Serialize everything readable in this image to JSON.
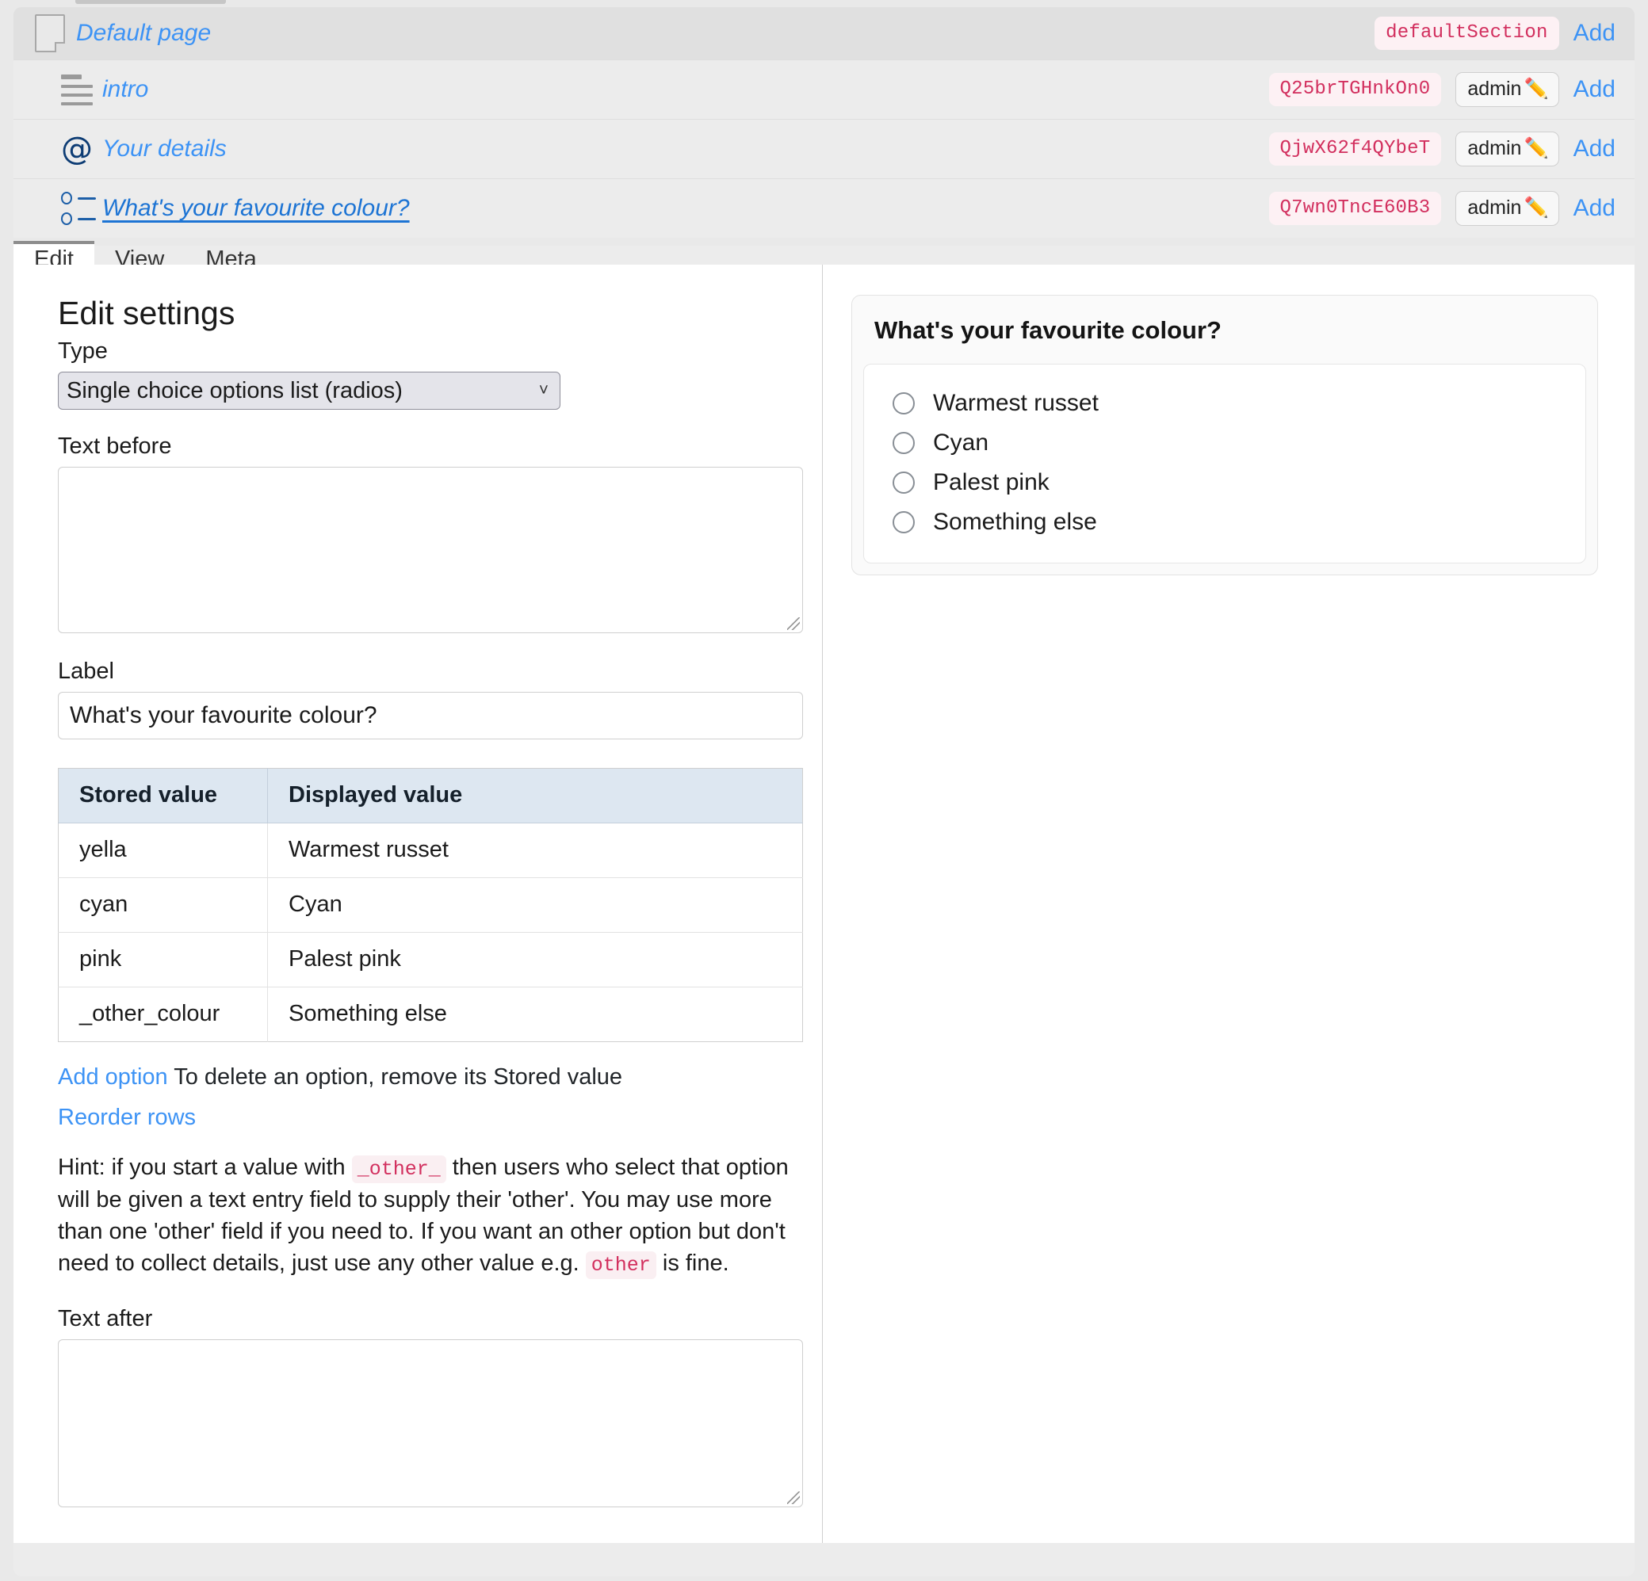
{
  "outline": {
    "rows": [
      {
        "icon": "page-icon",
        "title": "Default page",
        "code": "defaultSection",
        "owner": null,
        "add_label": "Add",
        "level": 0,
        "underlined": false
      },
      {
        "icon": "paragraph-icon",
        "title": "intro",
        "code": "Q25brTGHnkOn0",
        "owner": "admin",
        "owner_icon": "pencil-icon",
        "add_label": "Add",
        "level": 1,
        "underlined": false
      },
      {
        "icon": "at-icon",
        "title": "Your details",
        "code": "QjwX62f4QYbeT",
        "owner": "admin",
        "owner_icon": "pencil-icon",
        "add_label": "Add",
        "level": 1,
        "underlined": false
      },
      {
        "icon": "radio-list-icon",
        "title": "What's your favourite colour? ",
        "code": "Q7wn0TncE60B3",
        "owner": "admin",
        "owner_icon": "pencil-icon",
        "add_label": "Add",
        "level": 1,
        "underlined": true
      }
    ]
  },
  "tabs": [
    {
      "label": "Edit",
      "active": true
    },
    {
      "label": "View",
      "active": false
    },
    {
      "label": "Meta",
      "active": false
    }
  ],
  "edit": {
    "title": "Edit settings",
    "type_label": "Type",
    "type_value": "Single choice options list (radios)",
    "chevron": "⌄",
    "text_before_label": "Text before",
    "text_before_value": "",
    "label_label": "Label",
    "label_value": "What's your favourite colour?",
    "table": {
      "headers": [
        "Stored value",
        "Displayed value"
      ],
      "rows": [
        [
          "yella",
          "Warmest russet"
        ],
        [
          "cyan",
          "Cyan"
        ],
        [
          "pink",
          "Palest pink"
        ],
        [
          "_other_colour",
          "Something else"
        ]
      ]
    },
    "add_option_link": "Add option",
    "add_option_note": "To delete an option, remove its Stored value",
    "reorder_link": "Reorder rows",
    "hint": {
      "part1": "Hint: if you start a value with ",
      "code1": "_other_",
      "part2": " then users who select that option will be given a text entry field to supply their 'other'. You may use more than one 'other' field if you need to. If you want an other option but don't need to collect details, just use any other value e.g. ",
      "code2": "other",
      "part3": " is fine."
    },
    "text_after_label": "Text after",
    "text_after_value": ""
  },
  "preview": {
    "question": "What's your favourite colour?",
    "options": [
      "Warmest russet",
      "Cyan",
      "Palest pink",
      "Something else"
    ]
  },
  "colors": {
    "link": "#3d93f5",
    "code_text": "#d22f5e",
    "code_bg": "#fdf1f4",
    "table_header_bg": "#dde7f1",
    "row_level0_bg": "#e0e0e0",
    "row_level1_bg": "#ececec"
  }
}
